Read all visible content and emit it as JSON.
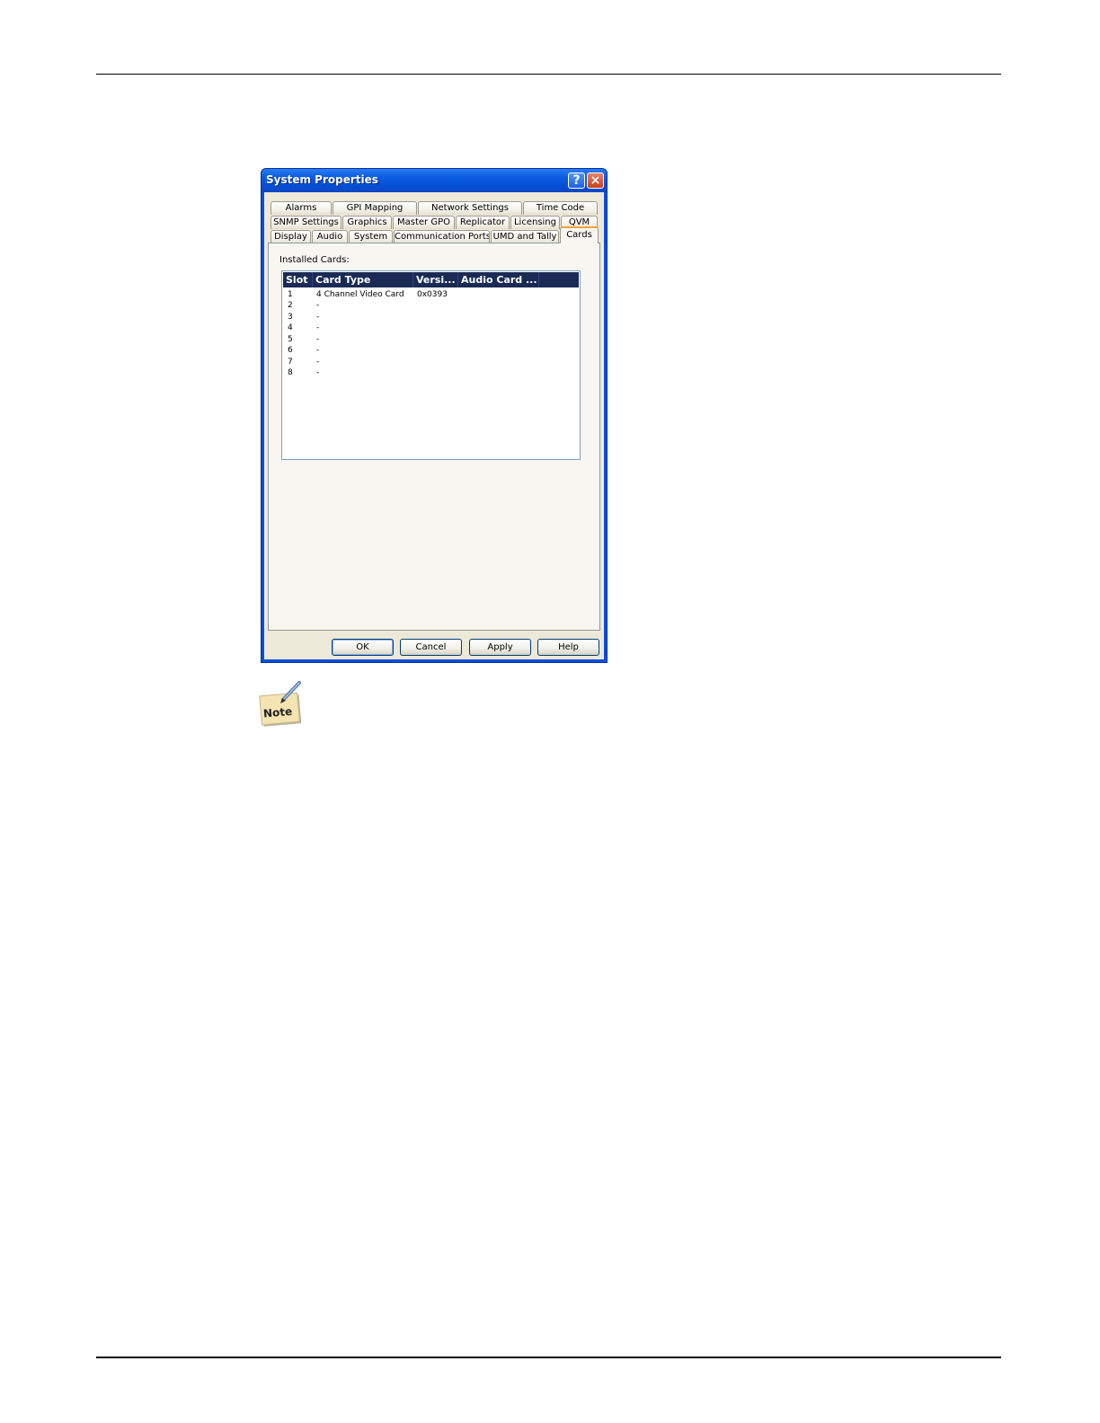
{
  "window": {
    "title": "System Properties",
    "help_glyph": "?",
    "close_glyph": "×"
  },
  "tabs": {
    "row1": [
      "Alarms",
      "GPI Mapping",
      "Network Settings",
      "Time Code"
    ],
    "row2": [
      "SNMP Settings",
      "Graphics",
      "Master GPO",
      "Replicator",
      "Licensing",
      "QVM"
    ],
    "row3": [
      "Display",
      "Audio",
      "System",
      "Communication Ports",
      "UMD and Tally",
      "Cards"
    ],
    "active": "Cards"
  },
  "cards_panel": {
    "installed_label": "Installed Cards:",
    "columns": [
      "Slot",
      "Card Type",
      "Versi...",
      "Audio Card ..."
    ],
    "rows": [
      {
        "slot": "1",
        "card_type": "4 Channel Video Card",
        "version": "0x0393",
        "audio": ""
      },
      {
        "slot": "2",
        "card_type": "-",
        "version": "",
        "audio": ""
      },
      {
        "slot": "3",
        "card_type": "-",
        "version": "",
        "audio": ""
      },
      {
        "slot": "4",
        "card_type": "-",
        "version": "",
        "audio": ""
      },
      {
        "slot": "5",
        "card_type": "-",
        "version": "",
        "audio": ""
      },
      {
        "slot": "6",
        "card_type": "-",
        "version": "",
        "audio": ""
      },
      {
        "slot": "7",
        "card_type": "-",
        "version": "",
        "audio": ""
      },
      {
        "slot": "8",
        "card_type": "-",
        "version": "",
        "audio": ""
      }
    ]
  },
  "buttons": {
    "ok": "OK",
    "cancel": "Cancel",
    "apply": "Apply",
    "help": "Help"
  },
  "note": {
    "label": "Note",
    "icon": "note-pencil-icon"
  },
  "colors": {
    "titlebar": "#0650d6",
    "list_header": "#1a2a55",
    "active_tab_accent": "#f2a43b",
    "dialog_face": "#ece9d8"
  }
}
